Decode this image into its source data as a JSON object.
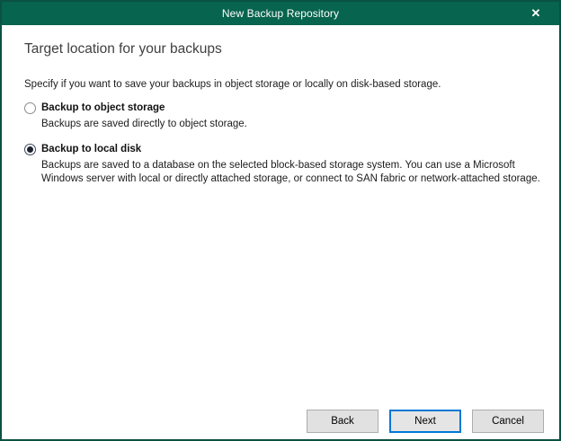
{
  "window": {
    "title": "New Backup Repository",
    "close_icon": "✕"
  },
  "heading": "Target location for your backups",
  "intro": "Specify if you want to save your backups in object storage or locally on disk-based storage.",
  "options": [
    {
      "label": "Backup to object storage",
      "description": "Backups are saved directly to object storage.",
      "selected": false
    },
    {
      "label": "Backup to local disk",
      "description": "Backups are saved to a database on the selected block-based storage system. You can use a Microsoft Windows server with local or directly attached storage, or connect to SAN fabric or network-attached storage.",
      "selected": true
    }
  ],
  "footer": {
    "back_label": "Back",
    "next_label": "Next",
    "cancel_label": "Cancel"
  },
  "colors": {
    "titlebar_green": "#07644e",
    "dialog_border_green": "#0a5142",
    "accent_blue": "#0078d7",
    "selected_radio_ring": "#3b4660",
    "selected_radio_dot": "#1d2130",
    "button_bg": "#e1e1e1",
    "button_border": "#adadad"
  }
}
